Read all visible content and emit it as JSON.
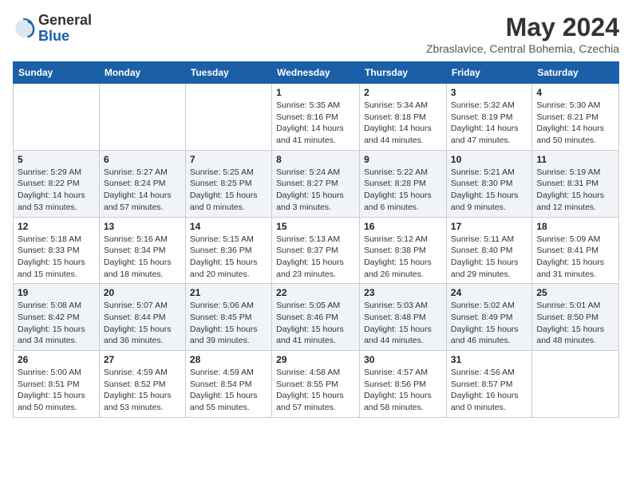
{
  "logo": {
    "general": "General",
    "blue": "Blue"
  },
  "header": {
    "month_year": "May 2024",
    "location": "Zbraslavice, Central Bohemia, Czechia"
  },
  "days_of_week": [
    "Sunday",
    "Monday",
    "Tuesday",
    "Wednesday",
    "Thursday",
    "Friday",
    "Saturday"
  ],
  "weeks": [
    [
      {
        "day": "",
        "info": ""
      },
      {
        "day": "",
        "info": ""
      },
      {
        "day": "",
        "info": ""
      },
      {
        "day": "1",
        "info": "Sunrise: 5:35 AM\nSunset: 8:16 PM\nDaylight: 14 hours\nand 41 minutes."
      },
      {
        "day": "2",
        "info": "Sunrise: 5:34 AM\nSunset: 8:18 PM\nDaylight: 14 hours\nand 44 minutes."
      },
      {
        "day": "3",
        "info": "Sunrise: 5:32 AM\nSunset: 8:19 PM\nDaylight: 14 hours\nand 47 minutes."
      },
      {
        "day": "4",
        "info": "Sunrise: 5:30 AM\nSunset: 8:21 PM\nDaylight: 14 hours\nand 50 minutes."
      }
    ],
    [
      {
        "day": "5",
        "info": "Sunrise: 5:29 AM\nSunset: 8:22 PM\nDaylight: 14 hours\nand 53 minutes."
      },
      {
        "day": "6",
        "info": "Sunrise: 5:27 AM\nSunset: 8:24 PM\nDaylight: 14 hours\nand 57 minutes."
      },
      {
        "day": "7",
        "info": "Sunrise: 5:25 AM\nSunset: 8:25 PM\nDaylight: 15 hours\nand 0 minutes."
      },
      {
        "day": "8",
        "info": "Sunrise: 5:24 AM\nSunset: 8:27 PM\nDaylight: 15 hours\nand 3 minutes."
      },
      {
        "day": "9",
        "info": "Sunrise: 5:22 AM\nSunset: 8:28 PM\nDaylight: 15 hours\nand 6 minutes."
      },
      {
        "day": "10",
        "info": "Sunrise: 5:21 AM\nSunset: 8:30 PM\nDaylight: 15 hours\nand 9 minutes."
      },
      {
        "day": "11",
        "info": "Sunrise: 5:19 AM\nSunset: 8:31 PM\nDaylight: 15 hours\nand 12 minutes."
      }
    ],
    [
      {
        "day": "12",
        "info": "Sunrise: 5:18 AM\nSunset: 8:33 PM\nDaylight: 15 hours\nand 15 minutes."
      },
      {
        "day": "13",
        "info": "Sunrise: 5:16 AM\nSunset: 8:34 PM\nDaylight: 15 hours\nand 18 minutes."
      },
      {
        "day": "14",
        "info": "Sunrise: 5:15 AM\nSunset: 8:36 PM\nDaylight: 15 hours\nand 20 minutes."
      },
      {
        "day": "15",
        "info": "Sunrise: 5:13 AM\nSunset: 8:37 PM\nDaylight: 15 hours\nand 23 minutes."
      },
      {
        "day": "16",
        "info": "Sunrise: 5:12 AM\nSunset: 8:38 PM\nDaylight: 15 hours\nand 26 minutes."
      },
      {
        "day": "17",
        "info": "Sunrise: 5:11 AM\nSunset: 8:40 PM\nDaylight: 15 hours\nand 29 minutes."
      },
      {
        "day": "18",
        "info": "Sunrise: 5:09 AM\nSunset: 8:41 PM\nDaylight: 15 hours\nand 31 minutes."
      }
    ],
    [
      {
        "day": "19",
        "info": "Sunrise: 5:08 AM\nSunset: 8:42 PM\nDaylight: 15 hours\nand 34 minutes."
      },
      {
        "day": "20",
        "info": "Sunrise: 5:07 AM\nSunset: 8:44 PM\nDaylight: 15 hours\nand 36 minutes."
      },
      {
        "day": "21",
        "info": "Sunrise: 5:06 AM\nSunset: 8:45 PM\nDaylight: 15 hours\nand 39 minutes."
      },
      {
        "day": "22",
        "info": "Sunrise: 5:05 AM\nSunset: 8:46 PM\nDaylight: 15 hours\nand 41 minutes."
      },
      {
        "day": "23",
        "info": "Sunrise: 5:03 AM\nSunset: 8:48 PM\nDaylight: 15 hours\nand 44 minutes."
      },
      {
        "day": "24",
        "info": "Sunrise: 5:02 AM\nSunset: 8:49 PM\nDaylight: 15 hours\nand 46 minutes."
      },
      {
        "day": "25",
        "info": "Sunrise: 5:01 AM\nSunset: 8:50 PM\nDaylight: 15 hours\nand 48 minutes."
      }
    ],
    [
      {
        "day": "26",
        "info": "Sunrise: 5:00 AM\nSunset: 8:51 PM\nDaylight: 15 hours\nand 50 minutes."
      },
      {
        "day": "27",
        "info": "Sunrise: 4:59 AM\nSunset: 8:52 PM\nDaylight: 15 hours\nand 53 minutes."
      },
      {
        "day": "28",
        "info": "Sunrise: 4:59 AM\nSunset: 8:54 PM\nDaylight: 15 hours\nand 55 minutes."
      },
      {
        "day": "29",
        "info": "Sunrise: 4:58 AM\nSunset: 8:55 PM\nDaylight: 15 hours\nand 57 minutes."
      },
      {
        "day": "30",
        "info": "Sunrise: 4:57 AM\nSunset: 8:56 PM\nDaylight: 15 hours\nand 58 minutes."
      },
      {
        "day": "31",
        "info": "Sunrise: 4:56 AM\nSunset: 8:57 PM\nDaylight: 16 hours\nand 0 minutes."
      },
      {
        "day": "",
        "info": ""
      }
    ]
  ]
}
